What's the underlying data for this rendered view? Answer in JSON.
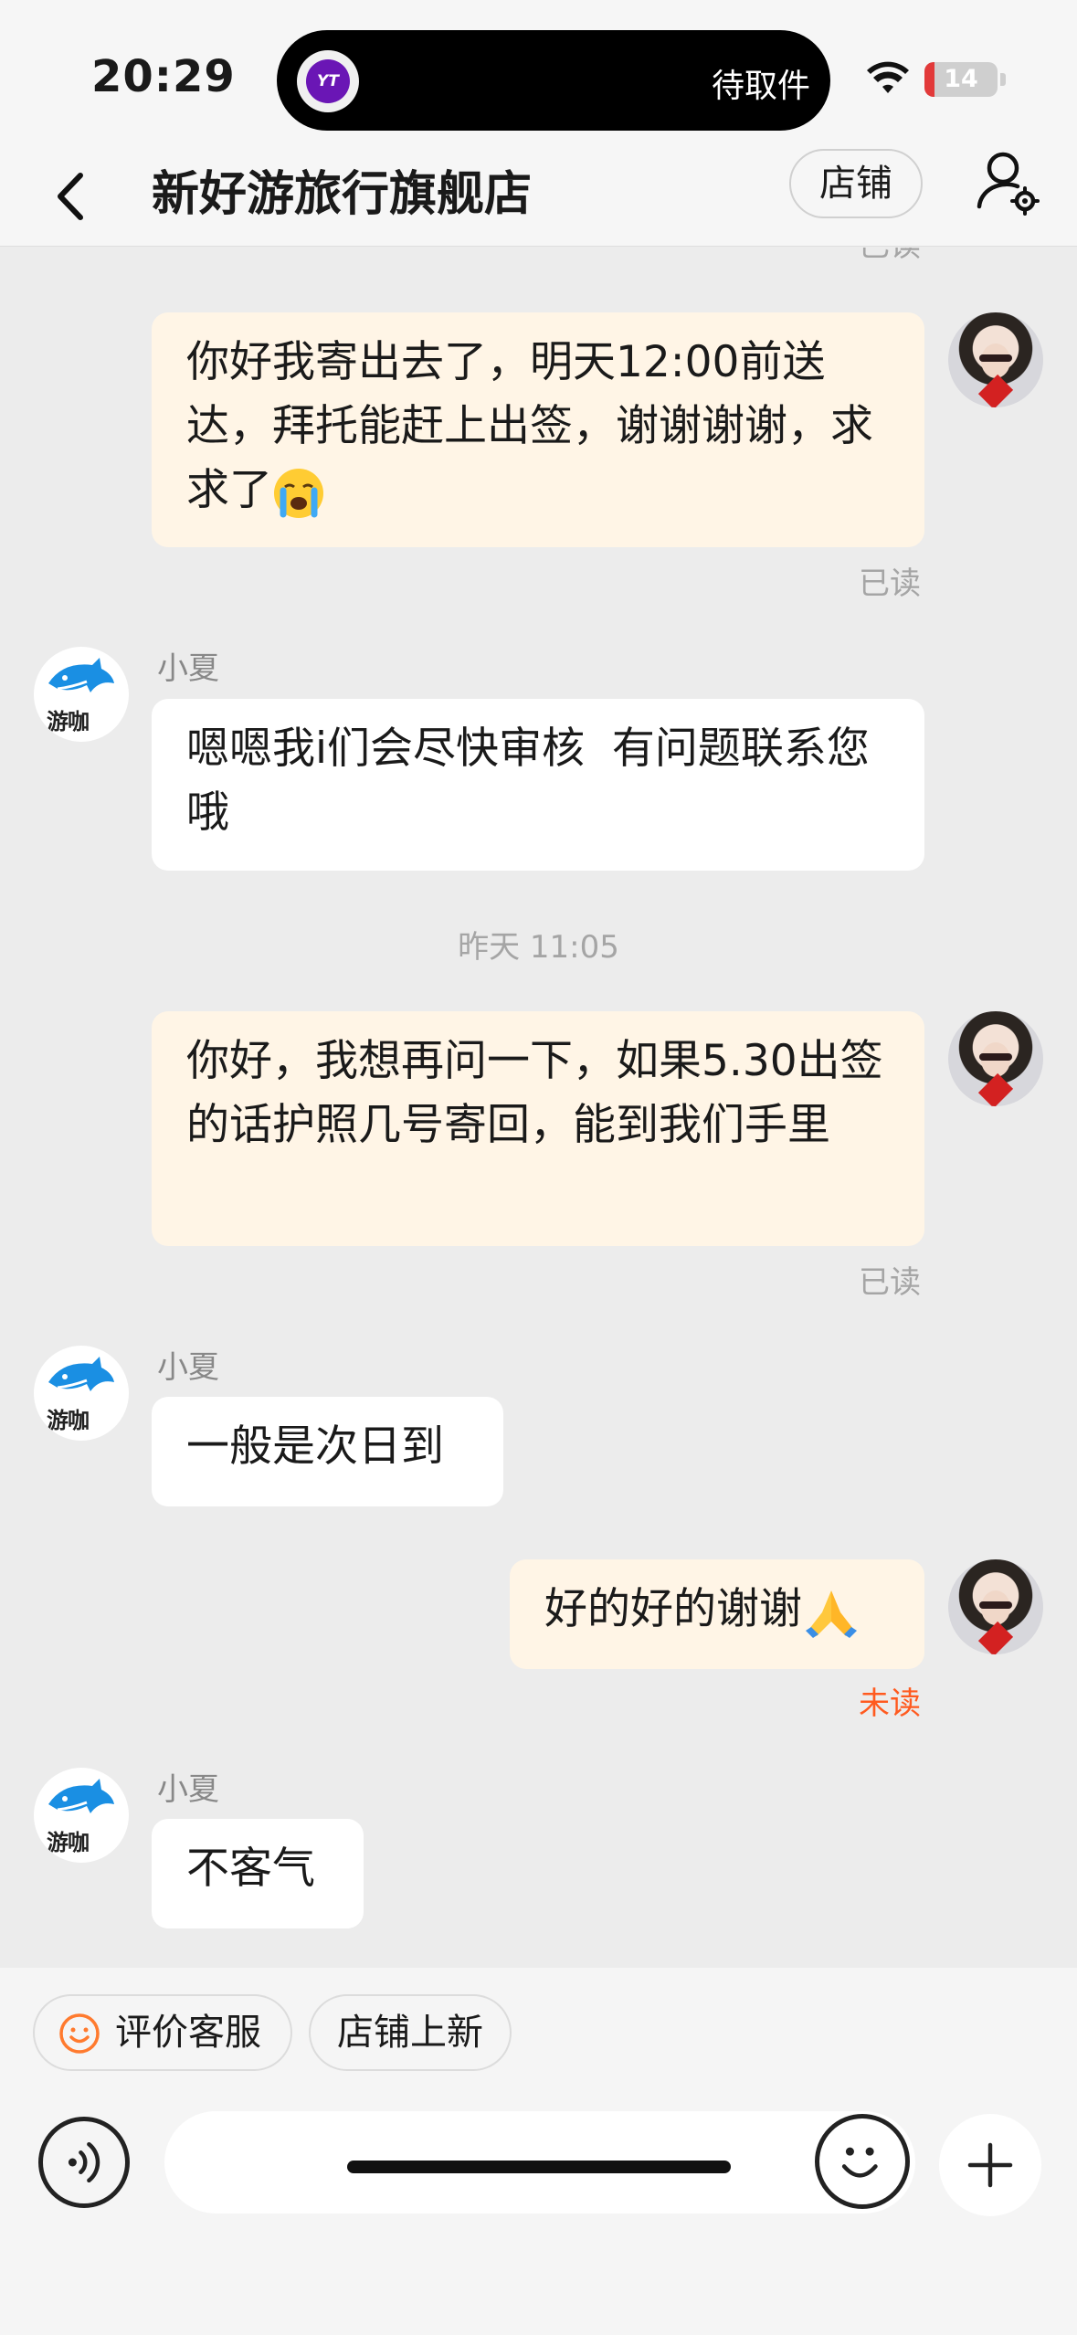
{
  "status_bar": {
    "time": "20:29",
    "island_app_label": "YT",
    "island_text": "待取件",
    "battery_level": "14",
    "battery_fraction": 0.14
  },
  "nav": {
    "title": "新好游旅行旗舰店",
    "shop_button": "店铺"
  },
  "chat": {
    "top_read_label": "已读",
    "messages": [
      {
        "side": "mine",
        "text": "你好我寄出去了，明天12:00前送达，拜托能赶上出签，谢谢谢谢，求求了",
        "emoji": "crying-face",
        "status": "已读"
      },
      {
        "side": "theirs",
        "sender": "小夏",
        "text": "嗯嗯我i们会尽快审核  有问题联系您哦"
      },
      {
        "timestamp": "昨天 11:05"
      },
      {
        "side": "mine",
        "text": "你好，我想再问一下，如果5.30出签的话护照几号寄回，能到我们手里",
        "status": "已读"
      },
      {
        "side": "theirs",
        "sender": "小夏",
        "text": "一般是次日到"
      },
      {
        "side": "mine",
        "text": "好的好的谢谢",
        "emoji": "folded-hands",
        "status": "未读"
      },
      {
        "side": "theirs",
        "sender": "小夏",
        "text": "不客气"
      }
    ],
    "shop_avatar_brand": "游咖"
  },
  "quick_bar": {
    "rate_service": "评价客服",
    "shop_new": "店铺上新"
  },
  "composer": {
    "input_value": "",
    "input_placeholder": ""
  },
  "colors": {
    "mine_bubble": "#fff5e6",
    "theirs_bubble": "#ffffff",
    "unread": "#ff5a1f",
    "accent_orange": "#ff7a2e",
    "shop_blue": "#1a8fe3"
  }
}
